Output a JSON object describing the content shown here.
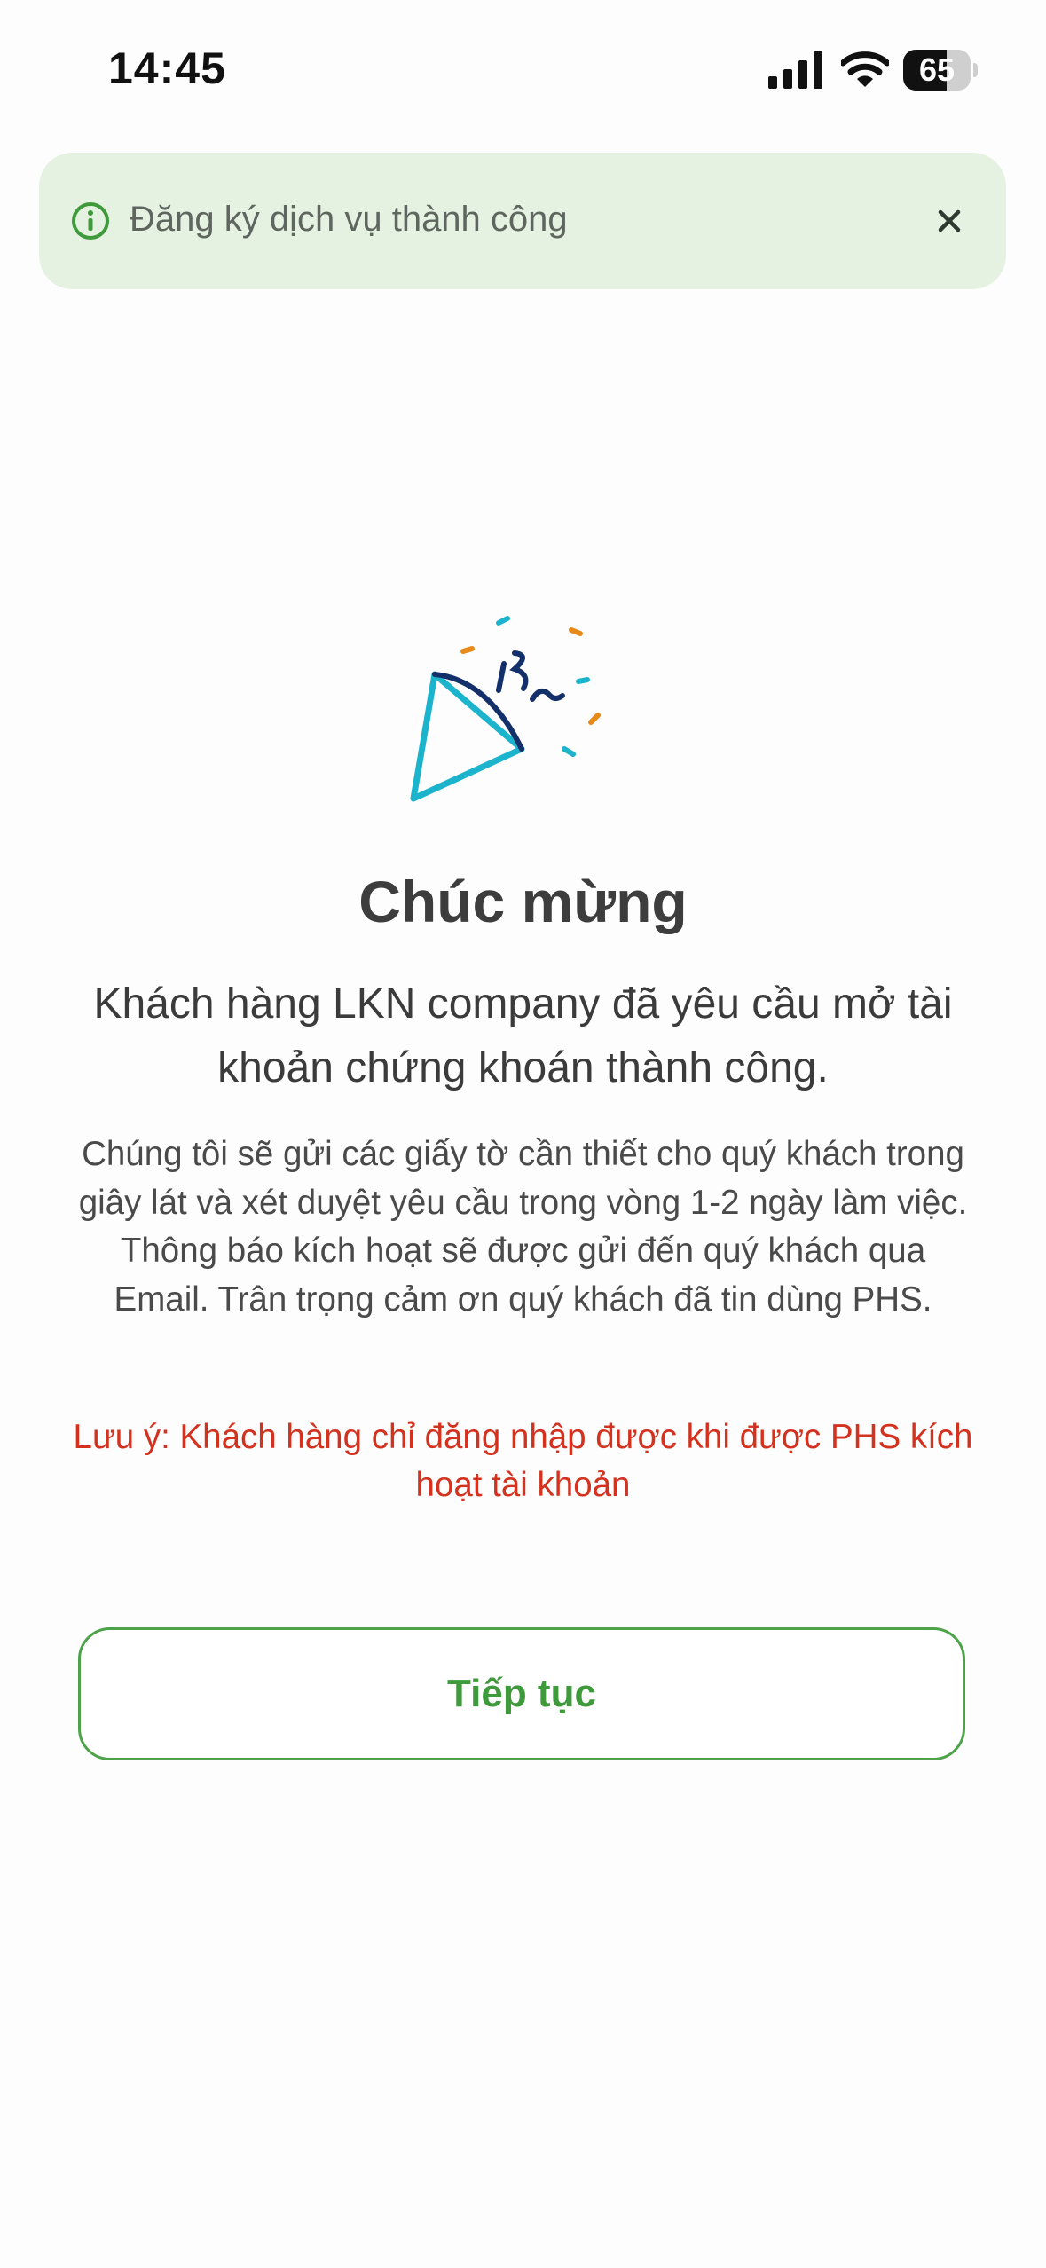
{
  "status_bar": {
    "time": "14:45",
    "battery_level": "65"
  },
  "toast": {
    "message": "Đăng ký dịch vụ thành công",
    "icon": "info-circle-icon",
    "close_icon": "close-icon"
  },
  "main": {
    "illustration": "party-popper-icon",
    "title": "Chúc mừng",
    "subtitle": "Khách hàng LKN company đã yêu cầu mở tài khoản chứng khoán thành công.",
    "body": "Chúng tôi sẽ gửi các giấy tờ cần thiết cho quý khách trong giây lát và xét duyệt yêu cầu trong vòng 1-2 ngày làm việc. Thông báo kích hoạt sẽ được gửi đến quý khách qua Email. Trân trọng cảm ơn quý khách đã tin dùng PHS.",
    "note": "Lưu ý: Khách hàng chỉ đăng nhập được khi được PHS kích hoạt tài khoản",
    "continue_label": "Tiếp tục"
  },
  "colors": {
    "accent_green": "#3f9a3b",
    "toast_bg": "#e5f2e1",
    "note_red": "#d3321f",
    "confetti_cyan": "#1cb4cc",
    "confetti_orange": "#e88a1a",
    "confetti_navy": "#14306a"
  }
}
